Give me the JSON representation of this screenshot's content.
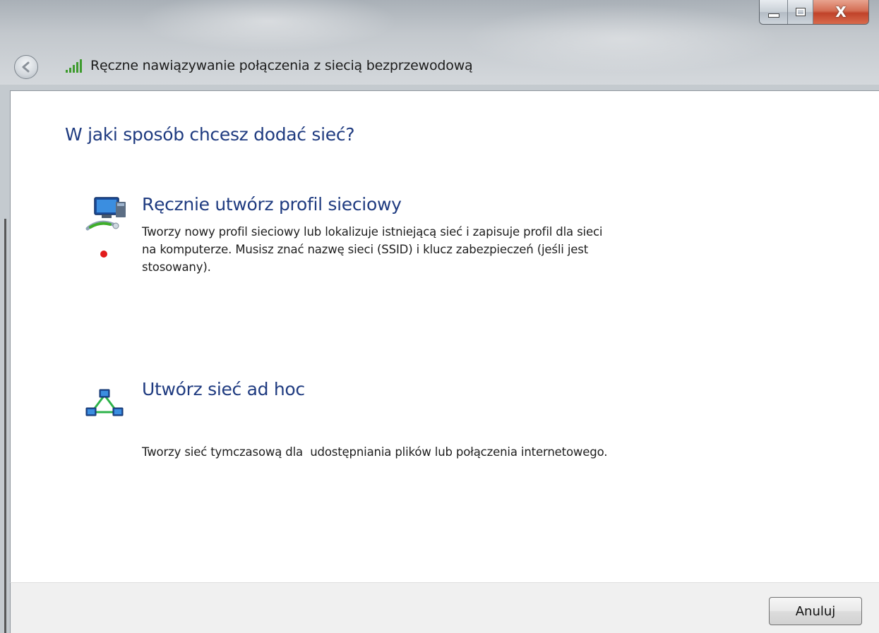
{
  "window": {
    "title": "Ręczne nawiązywanie połączenia z siecią bezprzewodową",
    "close_glyph": "X"
  },
  "main": {
    "heading": "W jaki sposób chcesz dodać sieć?",
    "options": [
      {
        "title": "Ręcznie utwórz profil sieciowy",
        "description_lines": [
          "Tworzy nowy profil sieciowy lub lokalizuje istniejącą sieć i zapisuje profil dla sieci",
          "na komputerze. Musisz znać nazwę sieci (SSID) i klucz zabezpieczeń (jeśli jest",
          "stosowany)."
        ],
        "icon": "network-computer-icon"
      },
      {
        "title": "Utwórz sieć ad hoc",
        "description_lines": [
          "Tworzy sieć tymczasową dla  udostępniania plików lub połączenia internetowego."
        ],
        "icon": "adhoc-network-icon"
      }
    ]
  },
  "footer": {
    "cancel_label": "Anuluj"
  },
  "colors": {
    "heading": "#1f3b80",
    "marker": "#e21b1b"
  }
}
